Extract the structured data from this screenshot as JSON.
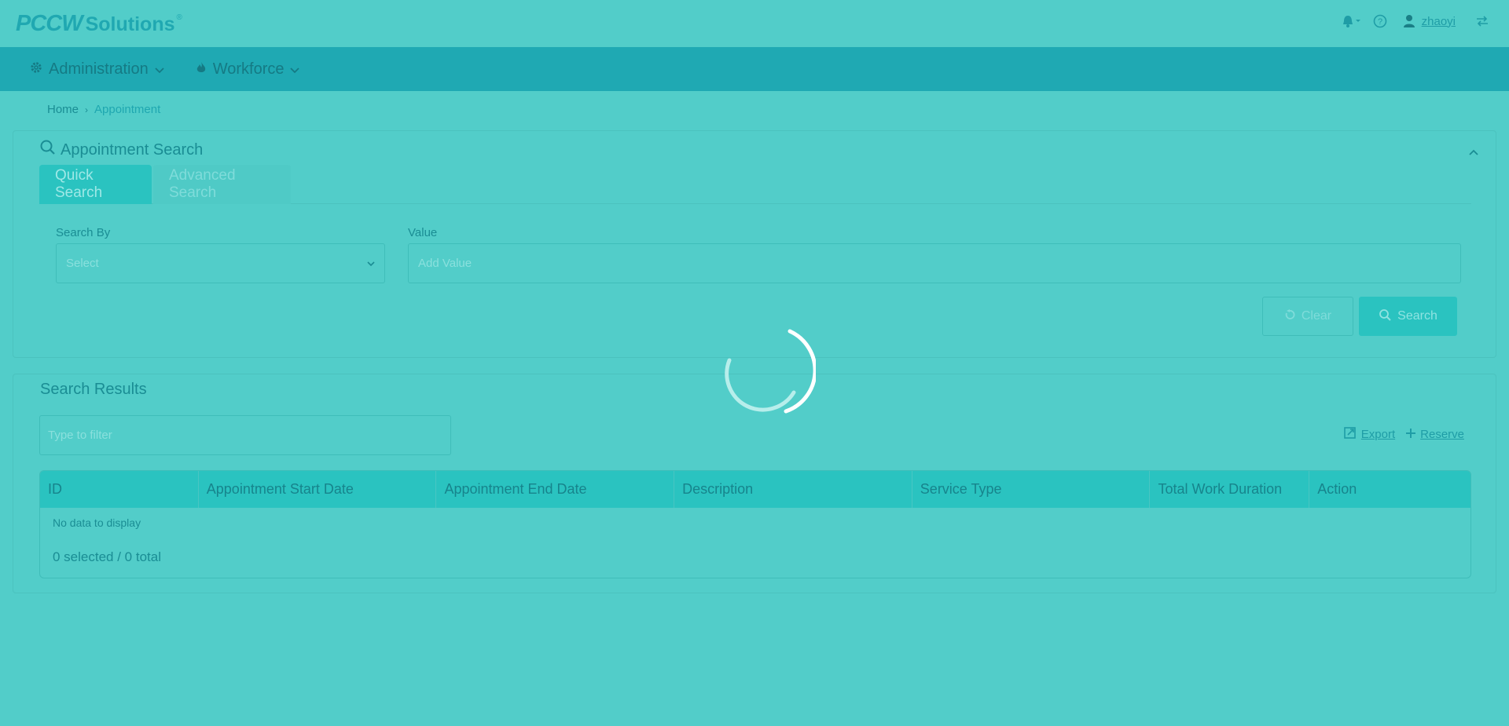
{
  "header": {
    "brand": "PCCW",
    "brand_suffix": "Solutions",
    "registered": "®",
    "username": "zhaoyi"
  },
  "nav": {
    "items": [
      {
        "label": "Administration",
        "icon": "gear-icon"
      },
      {
        "label": "Workforce",
        "icon": "flame-icon"
      }
    ]
  },
  "breadcrumb": {
    "home": "Home",
    "current": "Appointment"
  },
  "search_panel": {
    "title": "Appointment Search",
    "tabs": [
      {
        "label": "Quick Search",
        "active": true
      },
      {
        "label": "Advanced Search",
        "active": false
      }
    ],
    "search_by_label": "Search By",
    "search_by_placeholder": "Select",
    "value_label": "Value",
    "value_placeholder": "Add Value",
    "clear_label": "Clear",
    "search_label": "Search"
  },
  "results_panel": {
    "title": "Search Results",
    "filter_placeholder": "Type to filter",
    "export_label": "Export",
    "reserve_label": "Reserve",
    "columns": [
      "ID",
      "Appointment Start Date",
      "Appointment End Date",
      "Description",
      "Service Type",
      "Total Work Duration",
      "Action"
    ],
    "empty_message": "No data to display",
    "selection_summary": "0 selected / 0 total"
  },
  "colors": {
    "overlay": "#52cdc9",
    "navbar": "#1fa9b3",
    "accent": "#2ac3c0"
  }
}
